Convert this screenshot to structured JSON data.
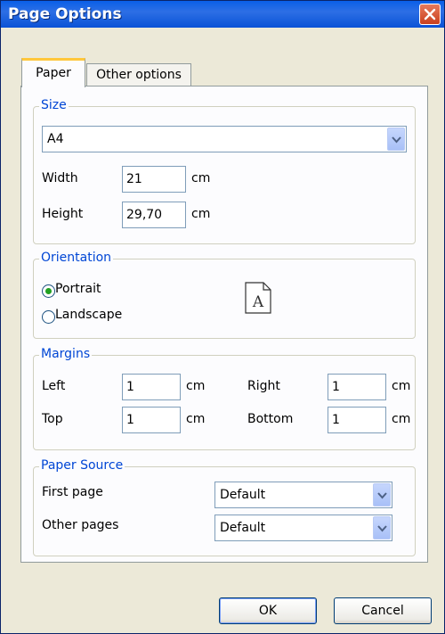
{
  "window": {
    "title": "Page Options"
  },
  "tabs": [
    {
      "label": "Paper"
    },
    {
      "label": "Other options"
    }
  ],
  "size": {
    "group_title": "Size",
    "paper_size": "A4",
    "width_label": "Width",
    "width_value": "21",
    "height_label": "Height",
    "height_value": "29,70",
    "unit": "cm"
  },
  "orientation": {
    "group_title": "Orientation",
    "portrait_label": "Portrait",
    "landscape_label": "Landscape",
    "selected": "Portrait",
    "preview_letter": "A"
  },
  "margins": {
    "group_title": "Margins",
    "left_label": "Left",
    "left_value": "1",
    "right_label": "Right",
    "right_value": "1",
    "top_label": "Top",
    "top_value": "1",
    "bottom_label": "Bottom",
    "bottom_value": "1",
    "unit": "cm"
  },
  "paper_source": {
    "group_title": "Paper Source",
    "first_page_label": "First page",
    "first_page_value": "Default",
    "other_pages_label": "Other pages",
    "other_pages_value": "Default"
  },
  "buttons": {
    "ok": "OK",
    "cancel": "Cancel"
  }
}
